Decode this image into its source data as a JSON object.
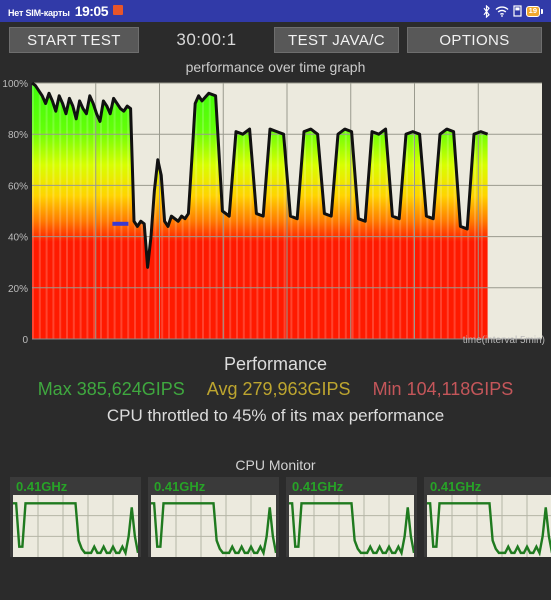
{
  "status_bar": {
    "carrier": "Нет SIM-карты",
    "clock": "19:05",
    "alarm_icon": "alarm-icon",
    "bluetooth_icon": "bluetooth-icon",
    "wifi_icon": "wifi-icon",
    "signal_icon": "signal-icon",
    "battery_icon": "battery-icon",
    "battery_level": "19",
    "background_color": "#313aa8"
  },
  "toolbar": {
    "start_test_label": "START TEST",
    "timer": "30:00:1",
    "test_java_label": "TEST JAVA/C",
    "options_label": "OPTIONS"
  },
  "graph": {
    "title": "performance over time graph",
    "xaxis_label": "time(interval 5min)",
    "y_ticks": [
      "100%",
      "80%",
      "60%",
      "40%",
      "20%",
      "0"
    ],
    "marker_color": "#3a3ad0",
    "plot_background": "#eceade",
    "line_color": "#111111"
  },
  "chart_data": {
    "type": "area",
    "title": "performance over time graph",
    "xlabel": "time(interval 5min)",
    "ylabel": "",
    "ylim": [
      0,
      100
    ],
    "xlim": [
      0,
      30
    ],
    "y_tick_values": [
      0,
      20,
      40,
      60,
      80,
      100
    ],
    "y_tick_labels": [
      "0",
      "20%",
      "40%",
      "60%",
      "80%",
      "100%"
    ],
    "grid": true,
    "fill_gradient": {
      "high": "#3dfc0a",
      "mid": "#ffff00",
      "low": "#ff1a00",
      "note": "fill color keyed to y value: green near 100%, yellow mid, red low"
    },
    "annotations": [
      {
        "label": "throttle marker",
        "y": 45,
        "x": 5.2,
        "color": "#3a3ad0"
      }
    ],
    "series": [
      {
        "name": "performance",
        "x": [
          0.0,
          0.2,
          0.4,
          0.6,
          0.8,
          1.0,
          1.2,
          1.4,
          1.6,
          1.8,
          2.0,
          2.2,
          2.4,
          2.6,
          2.8,
          3.0,
          3.2,
          3.4,
          3.6,
          3.8,
          4.0,
          4.2,
          4.4,
          4.6,
          4.8,
          5.0,
          5.2,
          5.4,
          5.6,
          5.8,
          6.0,
          6.2,
          6.4,
          6.6,
          6.8,
          7.0,
          7.2,
          7.4,
          7.6,
          7.8,
          8.0,
          8.2,
          8.4,
          8.6,
          8.8,
          9.0,
          9.2,
          9.4,
          9.6,
          9.8,
          10.0,
          10.4,
          10.8,
          11.2,
          11.6,
          12.0,
          12.4,
          12.8,
          13.2,
          13.6,
          14.0,
          14.4,
          14.8,
          15.2,
          15.6,
          16.0,
          16.4,
          16.8,
          17.2,
          17.6,
          18.0,
          18.4,
          18.8,
          19.2,
          19.6,
          20.0,
          20.4,
          20.8,
          21.2,
          21.6,
          22.0,
          22.4,
          22.8,
          23.2,
          23.6,
          24.0,
          24.4,
          24.8,
          25.2,
          25.6,
          26.0,
          26.4,
          26.8
        ],
        "y": [
          100,
          99,
          97,
          95,
          92,
          96,
          93,
          89,
          95,
          92,
          88,
          94,
          91,
          86,
          93,
          90,
          88,
          95,
          92,
          88,
          85,
          93,
          91,
          88,
          94,
          92,
          90,
          89,
          91,
          90,
          46,
          44,
          46,
          45,
          28,
          40,
          58,
          70,
          64,
          46,
          44,
          48,
          47,
          46,
          48,
          47,
          49,
          70,
          92,
          95,
          93,
          96,
          95,
          50,
          48,
          81,
          80,
          82,
          49,
          48,
          82,
          81,
          80,
          48,
          47,
          81,
          82,
          80,
          49,
          48,
          80,
          82,
          81,
          47,
          46,
          81,
          80,
          82,
          48,
          47,
          80,
          81,
          80,
          48,
          47,
          80,
          82,
          81,
          44,
          43,
          80,
          81,
          80
        ]
      }
    ]
  },
  "performance": {
    "heading": "Performance",
    "max_label": "Max 385,624GIPS",
    "avg_label": "Avg 279,963GIPS",
    "min_label": "Min 104,118GIPS",
    "throttle_text": "CPU throttled to 45% of its max performance",
    "max_color": "#3fa83f",
    "avg_color": "#bda52f",
    "min_color": "#c4565a"
  },
  "cpu_monitor": {
    "heading": "CPU Monitor",
    "cores": [
      {
        "freq": "0.41GHz"
      },
      {
        "freq": "0.41GHz"
      },
      {
        "freq": "0.41GHz"
      },
      {
        "freq": "0.41GHz"
      }
    ],
    "core_chart": {
      "type": "line",
      "line_color": "#1f7a1f",
      "background": "#eceade",
      "x": [
        0,
        1,
        2,
        3,
        4,
        5,
        6,
        7,
        8,
        9,
        10,
        11,
        12,
        13,
        14,
        15,
        16,
        17,
        18,
        19,
        20,
        21,
        22,
        23,
        24,
        25,
        26,
        27,
        28,
        29,
        30,
        31,
        32,
        33,
        34,
        35,
        36,
        37,
        38,
        39,
        40
      ],
      "y": [
        52,
        52,
        10,
        10,
        52,
        52,
        52,
        52,
        52,
        52,
        52,
        52,
        52,
        52,
        52,
        52,
        52,
        52,
        52,
        52,
        52,
        16,
        8,
        4,
        4,
        4,
        10,
        4,
        4,
        10,
        4,
        4,
        10,
        4,
        4,
        10,
        4,
        20,
        48,
        20,
        4
      ]
    }
  }
}
